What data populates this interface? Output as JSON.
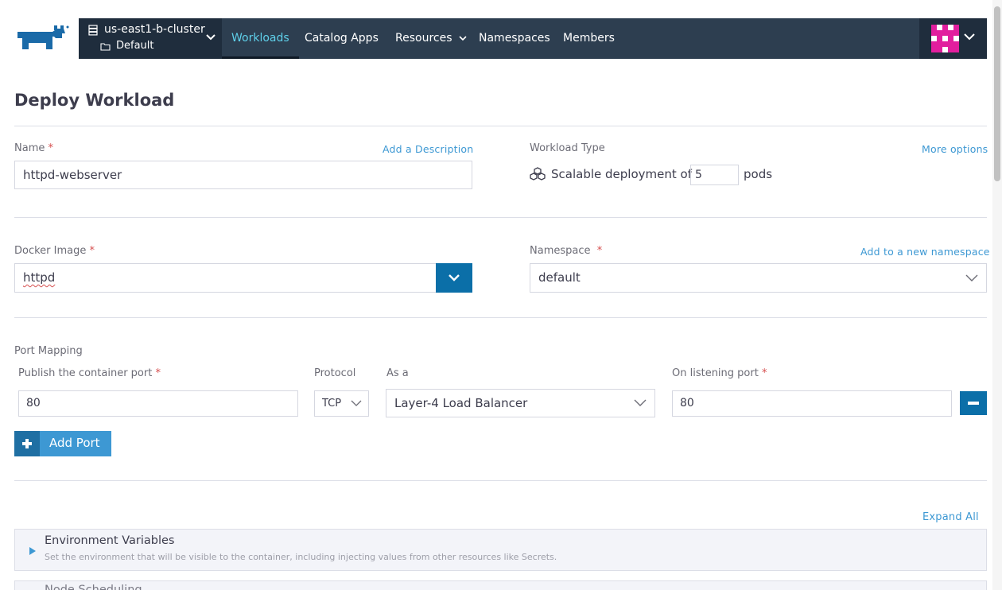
{
  "nav": {
    "cluster_name": "us-east1-b-cluster",
    "project_name": "Default",
    "items": [
      {
        "label": "Workloads"
      },
      {
        "label": "Catalog Apps"
      },
      {
        "label": "Resources"
      },
      {
        "label": "Namespaces"
      },
      {
        "label": "Members"
      }
    ]
  },
  "page": {
    "title": "Deploy Workload"
  },
  "form": {
    "name_label": "Name",
    "required_mark": "*",
    "add_description_link": "Add a Description",
    "name_value": "httpd-webserver",
    "workload_type_label": "Workload Type",
    "more_options_link": "More options",
    "scalable_text": "Scalable deployment of",
    "pod_count": "5",
    "pods_text": "pods",
    "docker_image_label": "Docker Image",
    "docker_image_value": "httpd",
    "namespace_label": "Namespace",
    "add_namespace_link": "Add to a new namespace",
    "namespace_value": "default"
  },
  "ports": {
    "section_label": "Port Mapping",
    "publish_label": "Publish the container port",
    "protocol_label": "Protocol",
    "as_a_label": "As a",
    "listening_label": "On listening port",
    "container_port": "80",
    "protocol": "TCP",
    "as_a_value": "Layer-4 Load Balancer",
    "listening_port": "80",
    "add_port_label": "Add Port"
  },
  "advanced": {
    "expand_all": "Expand All",
    "sections": [
      {
        "title": "Environment Variables",
        "description": "Set the environment that will be visible to the container, including injecting values from other resources like Secrets."
      },
      {
        "title": "Node Scheduling",
        "description": ""
      }
    ]
  },
  "colors": {
    "nav_bg": "#2d3e50",
    "nav_dark": "#1f2d3d",
    "active_nav": "#5fd0ea",
    "primary_button": "#0b6fa8",
    "link": "#3d98d3",
    "required": "#d64f4f",
    "avatar": "#e11e9e"
  }
}
